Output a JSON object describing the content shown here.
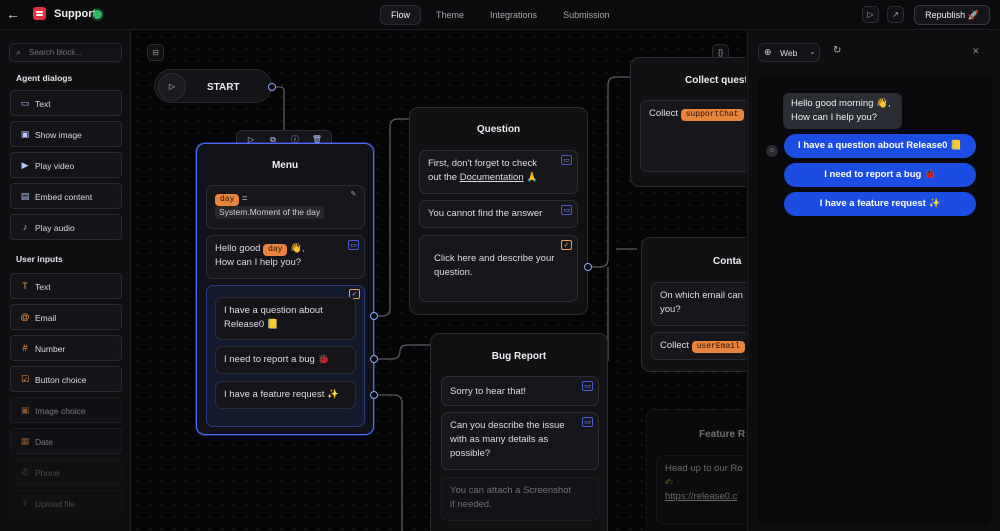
{
  "topbar": {
    "back_icon": "arrow-left-icon",
    "title": "Support",
    "tabs": [
      {
        "label": "Flow",
        "active": true
      },
      {
        "label": "Theme",
        "active": false
      },
      {
        "label": "Integrations",
        "active": false
      },
      {
        "label": "Submission",
        "active": false
      }
    ],
    "republish_label": "Republish 🚀"
  },
  "sidebar": {
    "search_placeholder": "Search block...",
    "sections": [
      {
        "title": "Agent dialogs",
        "blocks": [
          {
            "label": "Text",
            "icon": "message-icon"
          },
          {
            "label": "Show image",
            "icon": "image-icon"
          },
          {
            "label": "Play video",
            "icon": "video-icon"
          },
          {
            "label": "Embed content",
            "icon": "embed-icon"
          },
          {
            "label": "Play audio",
            "icon": "audio-icon"
          }
        ]
      },
      {
        "title": "User inputs",
        "blocks": [
          {
            "label": "Text",
            "icon": "text-cursor-icon"
          },
          {
            "label": "Email",
            "icon": "at-icon"
          },
          {
            "label": "Number",
            "icon": "hash-icon"
          },
          {
            "label": "Button choice",
            "icon": "checkbox-icon"
          },
          {
            "label": "Image choice",
            "icon": "image-choice-icon"
          },
          {
            "label": "Date",
            "icon": "calendar-icon"
          },
          {
            "label": "Phone",
            "icon": "phone-icon"
          },
          {
            "label": "Upload file",
            "icon": "upload-icon"
          }
        ]
      }
    ]
  },
  "canvas": {
    "start_label": "START",
    "menu": {
      "title": "Menu",
      "set_var_name": "day",
      "set_var_equals": "=",
      "set_var_value": "System.Moment of the day",
      "msg_line1_prefix": "Hello good",
      "msg_var": "day",
      "msg_emoji": "👋,",
      "msg_line2": "How can I help you?",
      "choices": [
        {
          "line1": "I have a question about",
          "line2": "Release0 📒"
        },
        {
          "line1": "I need to report a bug 🐞"
        },
        {
          "line1": "I have a feature request ✨"
        }
      ]
    },
    "question": {
      "title": "Question",
      "msg1_line1": "First, don't forget to check",
      "msg1_line2_prefix": "out the",
      "msg1_link": "Documentation",
      "msg1_emoji": "🙏",
      "msg2": "You cannot find the answer",
      "input_line1": "Click here and describe your",
      "input_line2": "question."
    },
    "collect_question": {
      "title": "Collect quest",
      "label": "Collect",
      "var": "supportChat"
    },
    "contact": {
      "title": "Conta",
      "line1": "On which email can",
      "line2": "you?",
      "label": "Collect",
      "var": "userEmail"
    },
    "bug_report": {
      "title": "Bug Report",
      "msg1": "Sorry to hear that!",
      "msg2_line1": "Can you describe the issue",
      "msg2_line2": "with as many details as",
      "msg2_line3": "possible?",
      "msg3_line1": "You can attach a Screenshot",
      "msg3_line2": "if needed."
    },
    "feature_request": {
      "title": "Feature R",
      "line1": "Head up to our Ro",
      "line2": "✍",
      "line3": "https://release0.c"
    }
  },
  "preview": {
    "platform": "Web",
    "greeting_line1": "Hello good morning 👋,",
    "greeting_line2": "How can I help you?",
    "choices": [
      "I have a question about Release0 📒",
      "I need to report a bug 🐞",
      "I have a feature request ✨"
    ]
  },
  "colors": {
    "accent_blue": "#1c4de3",
    "variable_orange": "#e8843e",
    "status_green": "#2fb861",
    "selection_border": "#4d6cff"
  }
}
